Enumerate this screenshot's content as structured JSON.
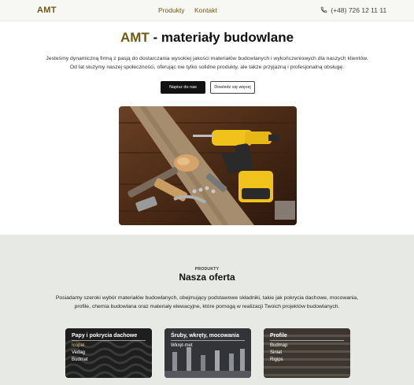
{
  "nav": {
    "logo": "AMT",
    "links": [
      "Produkty",
      "Kontakt"
    ],
    "phone": "(+48) 726 12 11 11",
    "accent_color": "#6d5a17"
  },
  "hero": {
    "title_brand": "AMT",
    "title_rest": " - materiały budowlane",
    "description_line1": "Jesteśmy dynamiczną firmą z pasją do dostarczania wysokiej jakości materiałów budowlanych i wykończeniowych dla naszych klientów.",
    "description_line2": "Od lat służymy naszej społeczności, oferując nie tylko solidne produkty, ale także przyjazną i profesjonalną obsługę.",
    "primary_button": "Napisz do nas",
    "secondary_button": "Dowiedz się więcej",
    "image_icon": "tools-photo"
  },
  "offer": {
    "eyebrow": "PRODUKTY",
    "title": "Nasza oferta",
    "description_line1": "Posiadamy szeroki wybór materiałów budowlanych, obejmujący podstawowe składniki, takie jak pokrycia dachowe, mocowania,",
    "description_line2": "profile, chemia budowlana oraz materiały elewacyjne, które pomogą w realizacji Twoich projektów budowlanych.",
    "cards": [
      {
        "title": "Papy i pokrycia dachowe",
        "items": [
          "Icopal",
          "Vedag",
          "Budmat"
        ],
        "active_color": "#e4d66a"
      },
      {
        "title": "Śruby, wkręty, mocowania",
        "items": [
          "Wkręt-met"
        ]
      },
      {
        "title": "Profile",
        "items": [
          "Budmap",
          "Siniat",
          "Rigips"
        ]
      }
    ]
  }
}
